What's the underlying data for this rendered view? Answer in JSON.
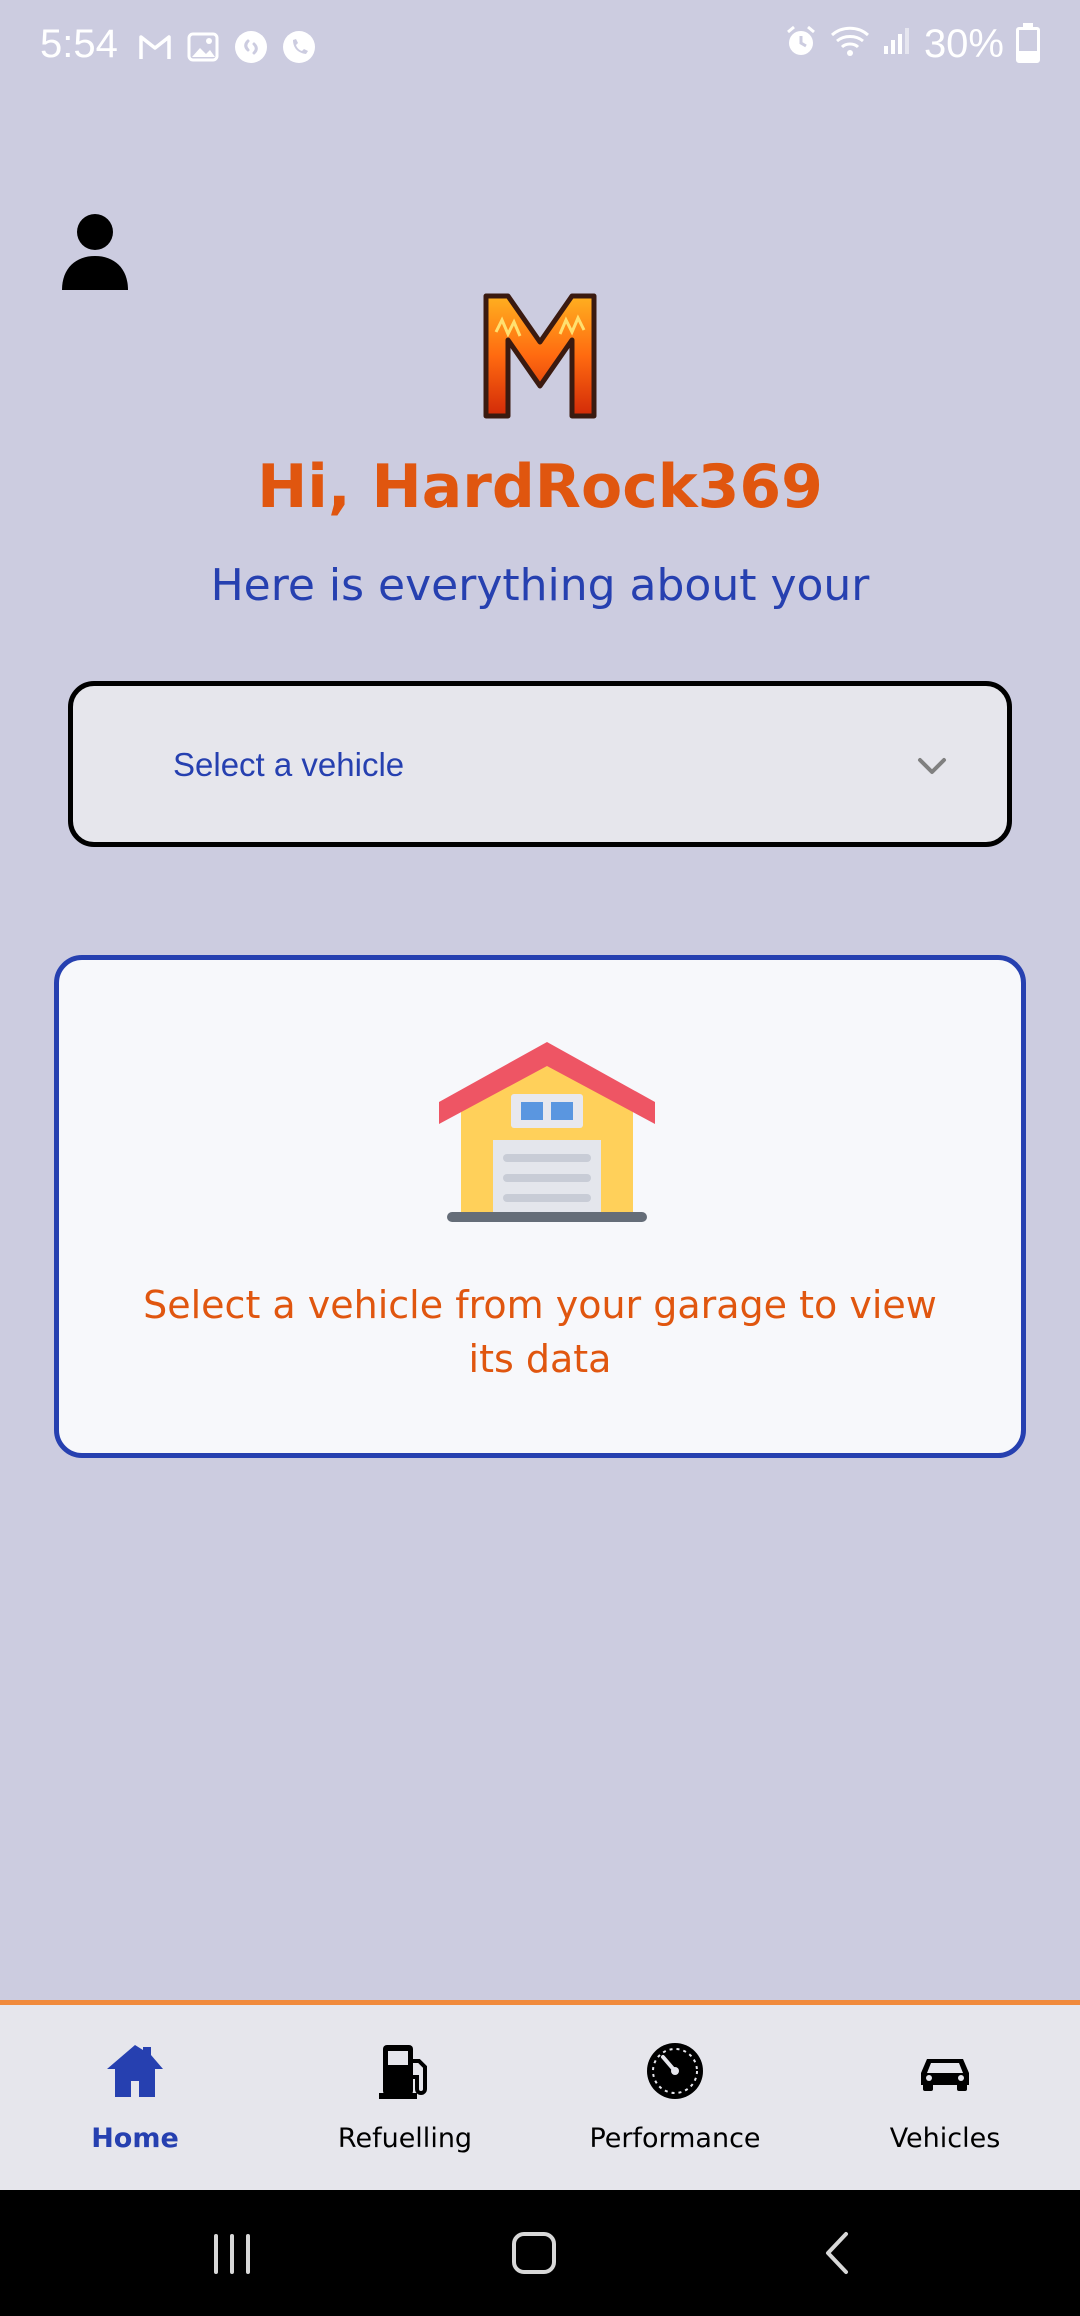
{
  "status_bar": {
    "time": "5:54",
    "battery": "30%",
    "battery_level": 0.3,
    "notification_icons": [
      "gmail-icon",
      "gallery-icon",
      "shazam-icon",
      "viber-icon"
    ],
    "system_icons": [
      "alarm-icon",
      "wifi-icon",
      "signal-icon",
      "battery-icon"
    ]
  },
  "header": {
    "greeting": "Hi, HardRock369",
    "subtitle": "Here is everything about your"
  },
  "vehicle_select": {
    "placeholder": "Select a vehicle"
  },
  "empty_state": {
    "message": "Select a vehicle from your garage to view its data"
  },
  "bottom_nav": {
    "items": [
      {
        "label": "Home",
        "icon": "home-icon",
        "active": true
      },
      {
        "label": "Refuelling",
        "icon": "fuel-pump-icon",
        "active": false
      },
      {
        "label": "Performance",
        "icon": "speedometer-icon",
        "active": false
      },
      {
        "label": "Vehicles",
        "icon": "car-icon",
        "active": false
      }
    ]
  },
  "colors": {
    "background": "#cccce0",
    "accent_orange": "#e0560f",
    "accent_blue": "#2640b0",
    "nav_border": "#f08a3c"
  }
}
